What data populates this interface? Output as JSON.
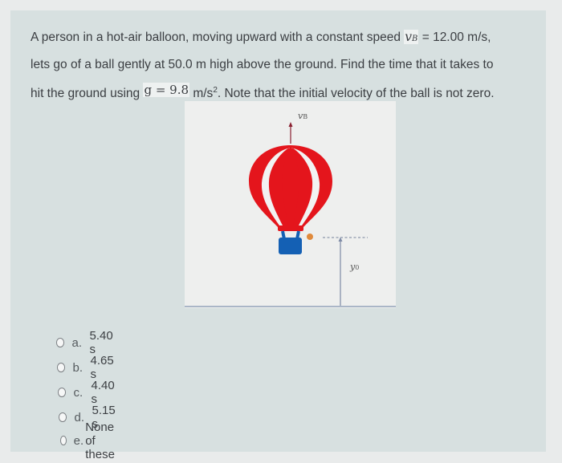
{
  "question": {
    "line1_prefix": "A person in a hot-air balloon, moving upward with a constant speed ",
    "vB_symbol": "v",
    "vB_subscript": "B",
    "vB_value": " = 12.00 m/s,",
    "line2": "lets go of a ball gently at 50.0 m high above the ground. Find the time that it takes to",
    "line3_prefix": "hit the ground using ",
    "g_expression": "g = 9.8",
    "g_units": " m/s",
    "g_units_exponent": "2",
    "line3_suffix": ". Note that the initial velocity of the ball is not zero."
  },
  "figure": {
    "velocity_label": "v",
    "velocity_label_sub": "B",
    "height_label": "y",
    "height_label_sub": "0",
    "colors": {
      "balloon": "#e4151c",
      "basket": "#1460b4",
      "ball": "#e08a3c",
      "arrow": "#8a2030",
      "guide": "#7d8aa5"
    }
  },
  "options": [
    {
      "letter": "a.",
      "text": "5.40 s",
      "selected": false
    },
    {
      "letter": "b.",
      "text": "4.65 s",
      "selected": false
    },
    {
      "letter": "c.",
      "text": "4.40 s",
      "selected": false
    },
    {
      "letter": "d.",
      "text": "5.15 s",
      "selected": false
    },
    {
      "letter": "e.",
      "text": "None of these",
      "selected": false
    }
  ]
}
